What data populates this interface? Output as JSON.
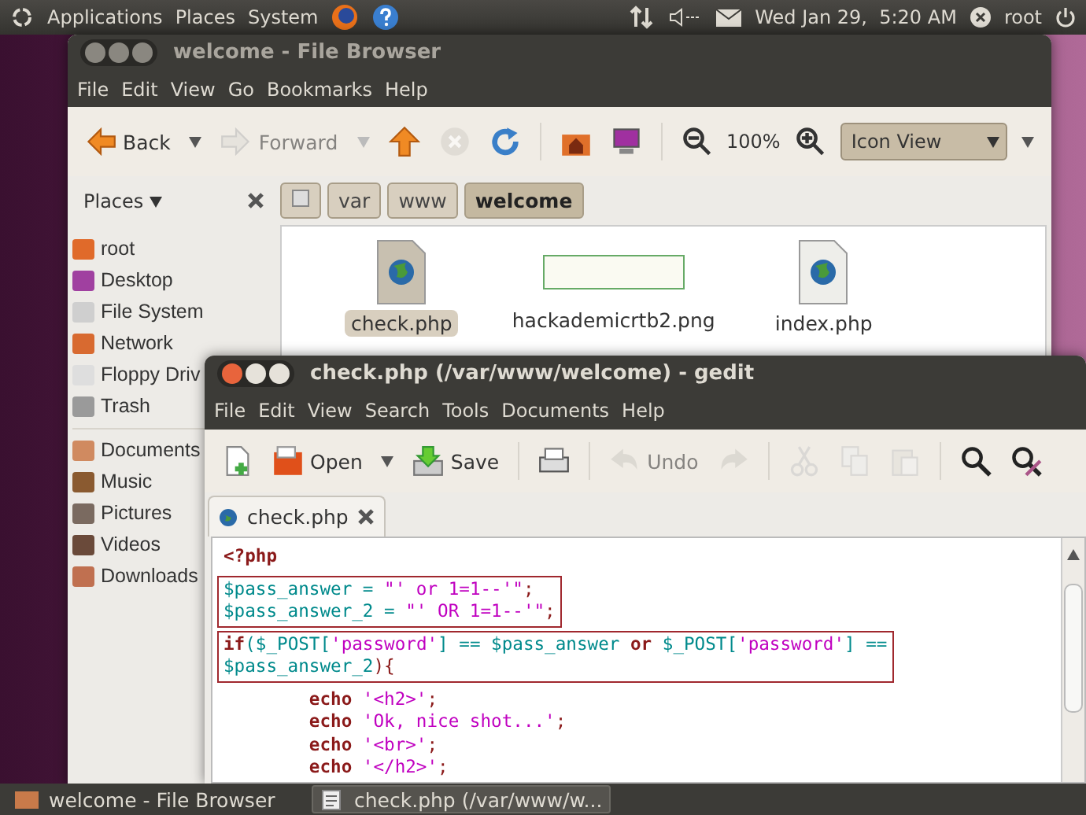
{
  "top_panel": {
    "menus": [
      "Applications",
      "Places",
      "System"
    ],
    "clock": "Wed Jan 29,  5:20 AM",
    "user": "root"
  },
  "file_browser": {
    "title": "welcome - File Browser",
    "menu": [
      "File",
      "Edit",
      "View",
      "Go",
      "Bookmarks",
      "Help"
    ],
    "toolbar": [
      {
        "kind": "back",
        "label": "Back",
        "disabled": false
      },
      {
        "kind": "dropdown",
        "disabled": false
      },
      {
        "kind": "forward",
        "label": "Forward",
        "disabled": true
      },
      {
        "kind": "dropdown",
        "disabled": true
      },
      {
        "kind": "up",
        "disabled": false
      },
      {
        "kind": "stop",
        "disabled": true
      },
      {
        "kind": "reload",
        "disabled": false
      },
      {
        "kind": "sep"
      },
      {
        "kind": "home",
        "disabled": false
      },
      {
        "kind": "computer",
        "disabled": false
      },
      {
        "kind": "sep"
      },
      {
        "kind": "zoom_out",
        "disabled": false
      },
      {
        "kind": "zoom_level",
        "label": "100%"
      },
      {
        "kind": "zoom_in",
        "disabled": false
      },
      {
        "kind": "view_combo",
        "label": "Icon View"
      },
      {
        "kind": "dropdown",
        "disabled": false
      }
    ],
    "sidebar": {
      "title": "Places",
      "sections": [
        {
          "items": [
            {
              "label": "root",
              "kind": "home"
            },
            {
              "label": "Desktop",
              "kind": "desktop"
            },
            {
              "label": "File System",
              "kind": "drive"
            },
            {
              "label": "Network",
              "kind": "network"
            },
            {
              "label": "Floppy Driv",
              "kind": "floppy"
            },
            {
              "label": "Trash",
              "kind": "trash"
            }
          ]
        },
        {
          "items": [
            {
              "label": "Documents",
              "kind": "folder"
            },
            {
              "label": "Music",
              "kind": "music"
            },
            {
              "label": "Pictures",
              "kind": "pictures"
            },
            {
              "label": "Videos",
              "kind": "videos"
            },
            {
              "label": "Downloads",
              "kind": "downloads"
            }
          ]
        }
      ]
    },
    "path": [
      {
        "label": "var",
        "selected": false
      },
      {
        "label": "www",
        "selected": false
      },
      {
        "label": "welcome",
        "selected": true
      }
    ],
    "files": [
      {
        "name": "check.php",
        "kind": "php",
        "selected": true
      },
      {
        "name": "hackademicrtb2.png",
        "kind": "image",
        "selected": false
      },
      {
        "name": "index.php",
        "kind": "php",
        "selected": false
      }
    ]
  },
  "gedit": {
    "title": "check.php (/var/www/welcome) - gedit",
    "menu": [
      "File",
      "Edit",
      "View",
      "Search",
      "Tools",
      "Documents",
      "Help"
    ],
    "toolbar": [
      {
        "kind": "new",
        "disabled": false
      },
      {
        "kind": "open",
        "label": "Open",
        "disabled": false
      },
      {
        "kind": "dropdown",
        "disabled": false
      },
      {
        "kind": "save",
        "label": "Save",
        "disabled": false
      },
      {
        "kind": "sep"
      },
      {
        "kind": "print",
        "disabled": false
      },
      {
        "kind": "sep"
      },
      {
        "kind": "undo",
        "label": "Undo",
        "disabled": true
      },
      {
        "kind": "redo",
        "disabled": true
      },
      {
        "kind": "sep"
      },
      {
        "kind": "cut",
        "disabled": true
      },
      {
        "kind": "copy",
        "disabled": true
      },
      {
        "kind": "paste",
        "disabled": true
      },
      {
        "kind": "sep"
      },
      {
        "kind": "find",
        "disabled": false
      },
      {
        "kind": "replace",
        "disabled": false
      }
    ],
    "tab": "check.php",
    "code_blocks": [
      {
        "highlighted": false,
        "lines": [
          [
            {
              "text": "<?php",
              "kind": "keyword"
            }
          ]
        ]
      },
      {
        "highlighted": true,
        "lines": [
          [
            {
              "text": "$pass_answer = ",
              "kind": "variable"
            },
            {
              "text": "\"' or 1=1--'\"",
              "kind": "string"
            },
            {
              "text": ";",
              "kind": "plain"
            }
          ],
          [
            {
              "text": "$pass_answer_2 = ",
              "kind": "variable"
            },
            {
              "text": "\"' OR 1=1--'\"",
              "kind": "string"
            },
            {
              "text": ";",
              "kind": "plain"
            }
          ]
        ]
      },
      {
        "highlighted": true,
        "lines": [
          [
            {
              "text": "if",
              "kind": "keyword"
            },
            {
              "text": "($_POST[",
              "kind": "variable"
            },
            {
              "text": "'password'",
              "kind": "string"
            },
            {
              "text": "] == $pass_answer ",
              "kind": "variable"
            },
            {
              "text": "or",
              "kind": "keyword"
            },
            {
              "text": " $_POST[",
              "kind": "variable"
            },
            {
              "text": "'password'",
              "kind": "string"
            },
            {
              "text": "] ==",
              "kind": "variable"
            }
          ],
          [
            {
              "text": "$pass_answer_2",
              "kind": "variable"
            },
            {
              "text": "){",
              "kind": "plain"
            }
          ]
        ]
      },
      {
        "highlighted": false,
        "lines": [
          [
            {
              "text": "        echo ",
              "kind": "keyword"
            },
            {
              "text": "'<h2>'",
              "kind": "string"
            },
            {
              "text": ";",
              "kind": "plain"
            }
          ],
          [
            {
              "text": "        echo ",
              "kind": "keyword"
            },
            {
              "text": "'Ok, nice shot...'",
              "kind": "string"
            },
            {
              "text": ";",
              "kind": "plain"
            }
          ],
          [
            {
              "text": "        echo ",
              "kind": "keyword"
            },
            {
              "text": "'<br>'",
              "kind": "string"
            },
            {
              "text": ";",
              "kind": "plain"
            }
          ],
          [
            {
              "text": "        echo ",
              "kind": "keyword"
            },
            {
              "text": "'</h2>'",
              "kind": "string"
            },
            {
              "text": ";",
              "kind": "plain"
            }
          ]
        ]
      }
    ]
  },
  "taskbar": [
    {
      "label": "welcome - File Browser",
      "kind": "folder",
      "selected": false
    },
    {
      "label": "check.php (/var/www/w...",
      "kind": "editor",
      "selected": true
    }
  ]
}
